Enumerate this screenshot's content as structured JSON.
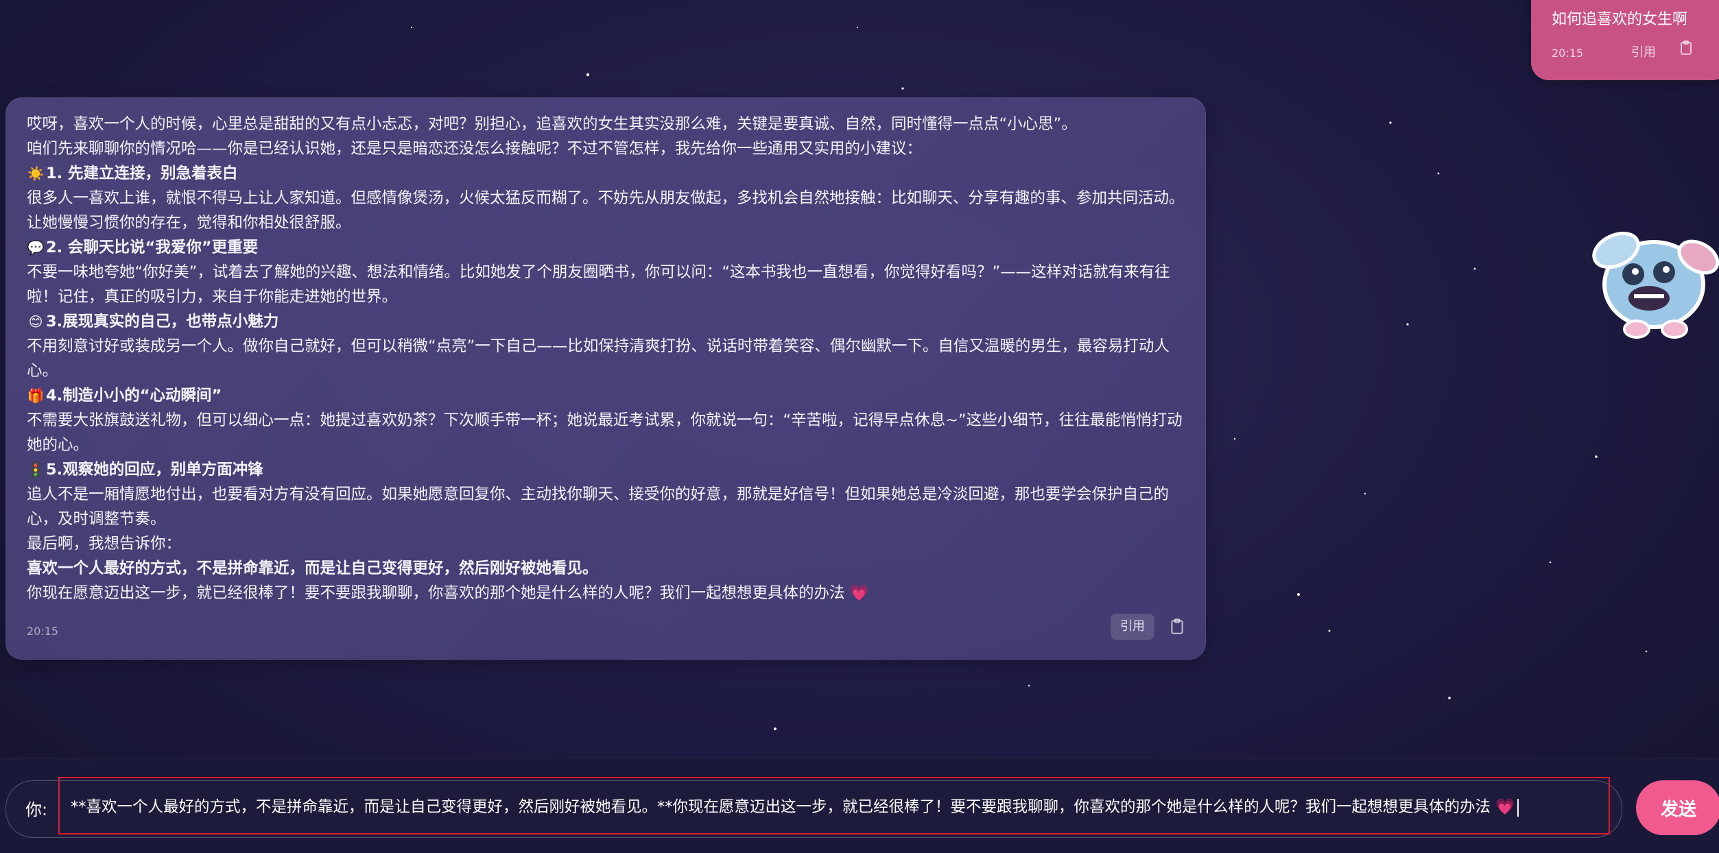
{
  "user_message": {
    "text": "如何追喜欢的女生啊",
    "time": "20:15",
    "quote_label": "引用",
    "copy_icon": "clipboard-icon"
  },
  "assistant_message": {
    "intro_1": "哎呀，喜欢一个人的时候，心里总是甜甜的又有点小忐忑，对吧？别担心，追喜欢的女生其实没那么难，关键是要真诚、自然，同时懂得一点点“小心思”。",
    "intro_2": "咱们先来聊聊你的情况哈——你是已经认识她，还是只是暗恋还没怎么接触呢？不过不管怎样，我先给你一些通用又实用的小建议：",
    "tips": [
      {
        "emoji": "☀️",
        "title": "1. 先建立连接，别急着表白",
        "body": "很多人一喜欢上谁，就恨不得马上让人家知道。但感情像煲汤，火候太猛反而糊了。不妨先从朋友做起，多找机会自然地接触：比如聊天、分享有趣的事、参加共同活动。让她慢慢习惯你的存在，觉得和你相处很舒服。"
      },
      {
        "emoji": "💬",
        "title": "2. 会聊天比说“我爱你”更重要",
        "body": "不要一味地夸她“你好美”，试着去了解她的兴趣、想法和情绪。比如她发了个朋友圈晒书，你可以问：“这本书我也一直想看，你觉得好看吗？”——这样对话就有来有往啦！记住，真正的吸引力，来自于你能走进她的世界。"
      },
      {
        "emoji": "😊",
        "title": "3.展现真实的自己，也带点小魅力",
        "body": "不用刻意讨好或装成另一个人。做你自己就好，但可以稍微“点亮”一下自己——比如保持清爽打扮、说话时带着笑容、偶尔幽默一下。自信又温暖的男生，最容易打动人心。"
      },
      {
        "emoji": "🎁",
        "title": "4.制造小小的“心动瞬间”",
        "body": "不需要大张旗鼓送礼物，但可以细心一点：她提过喜欢奶茶？下次顺手带一杯；她说最近考试累，你就说一句：“辛苦啦，记得早点休息~”这些小细节，往往最能悄悄打动她的心。"
      },
      {
        "emoji": "🚦",
        "title": "5.观察她的回应，别单方面冲锋",
        "body": "追人不是一厢情愿地付出，也要看对方有没有回应。如果她愿意回复你、主动找你聊天、接受你的好意，那就是好信号！但如果她总是冷淡回避，那也要学会保护自己的心，及时调整节奏。"
      }
    ],
    "closing_lead": "最后啊，我想告诉你：",
    "closing_bold": "喜欢一个人最好的方式，不是拼命靠近，而是让自己变得更好，然后刚好被她看见。",
    "closing_last": "你现在愿意迈出这一步，就已经很棒了！要不要跟我聊聊，你喜欢的那个她是什么样的人呢？我们一起想想更具体的办法",
    "closing_emoji": "💗",
    "time": "20:15",
    "quote_label": "引用",
    "copy_icon": "clipboard-icon"
  },
  "input": {
    "prefix": "你:",
    "value": "**喜欢一个人最好的方式，不是拼命靠近，而是让自己变得更好，然后刚好被她看见。**你现在愿意迈出这一步，就已经很棒了！要不要跟我聊聊，你喜欢的那个她是什么样的人呢？我们一起想想更具体的办法 💗",
    "send_label": "发送"
  },
  "colors": {
    "background": "#1f1c45",
    "user_bubble": "#c95285",
    "send_button": "#f05a8f",
    "highlight_border": "#e0192f"
  }
}
